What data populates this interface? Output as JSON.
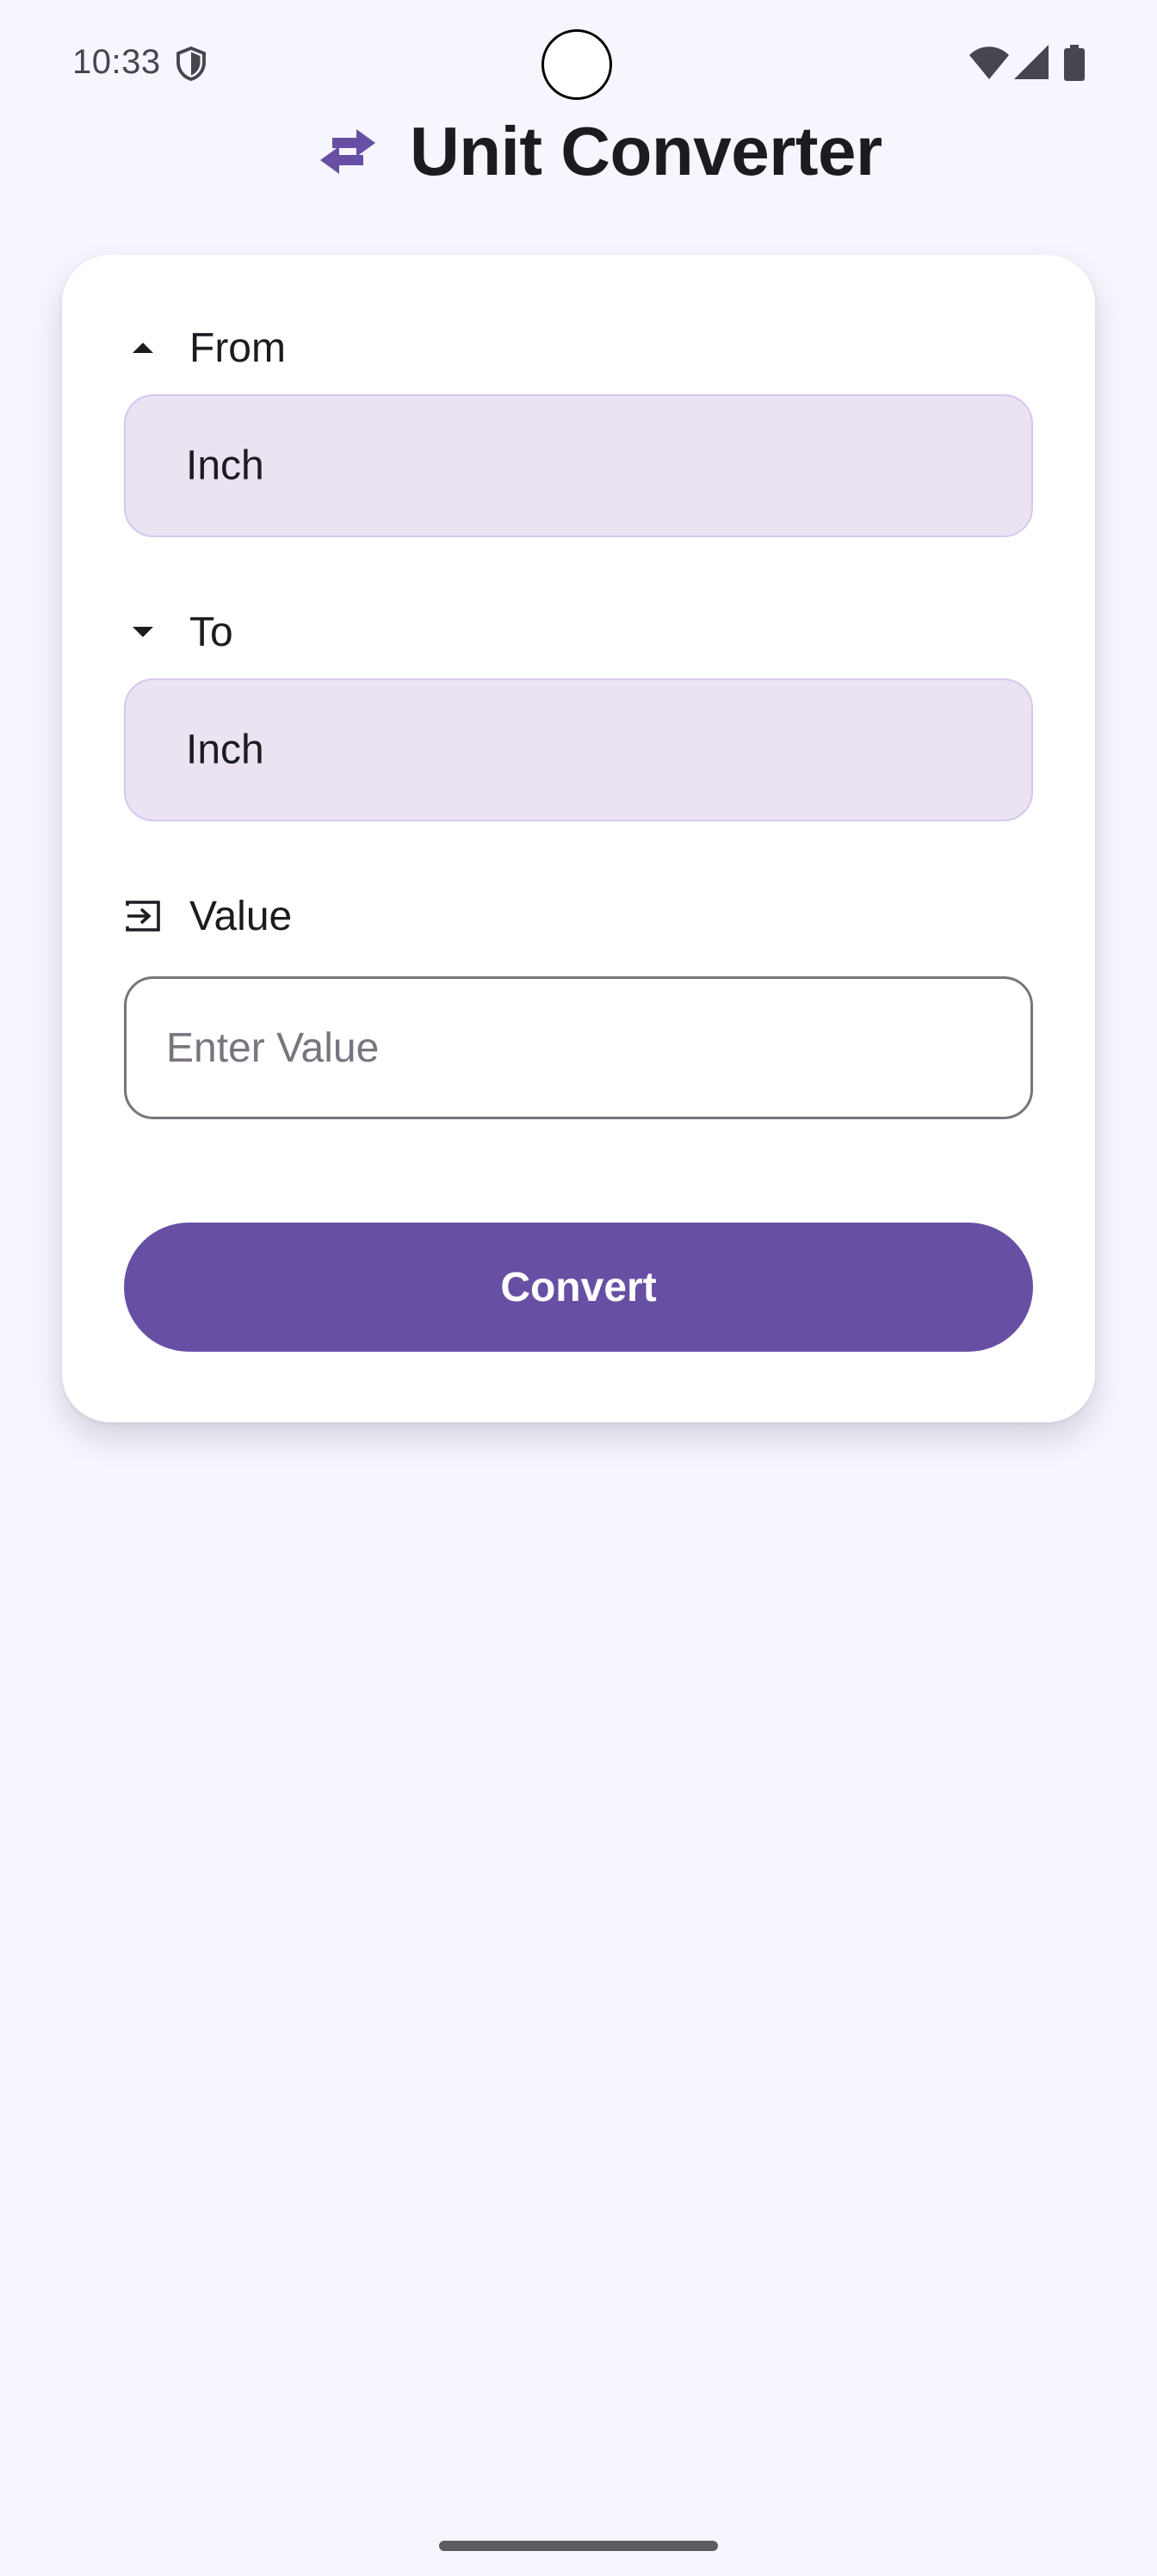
{
  "status_bar": {
    "time": "10:33",
    "icons": [
      "shield-icon",
      "wifi-icon",
      "signal-icon",
      "battery-icon"
    ]
  },
  "header": {
    "title": "Unit Converter",
    "icon": "swap-horizontal-icon"
  },
  "form": {
    "from": {
      "label": "From",
      "icon": "arrow-drop-up-icon",
      "selected": "Inch"
    },
    "to": {
      "label": "To",
      "icon": "arrow-drop-down-icon",
      "selected": "Inch"
    },
    "value": {
      "label": "Value",
      "icon": "input-icon",
      "placeholder": "Enter Value",
      "current": ""
    },
    "convert_label": "Convert"
  },
  "colors": {
    "background": "#f7f5fd",
    "primary": "#6750a4",
    "select_fill": "#ebe2f2",
    "card": "#ffffff"
  }
}
